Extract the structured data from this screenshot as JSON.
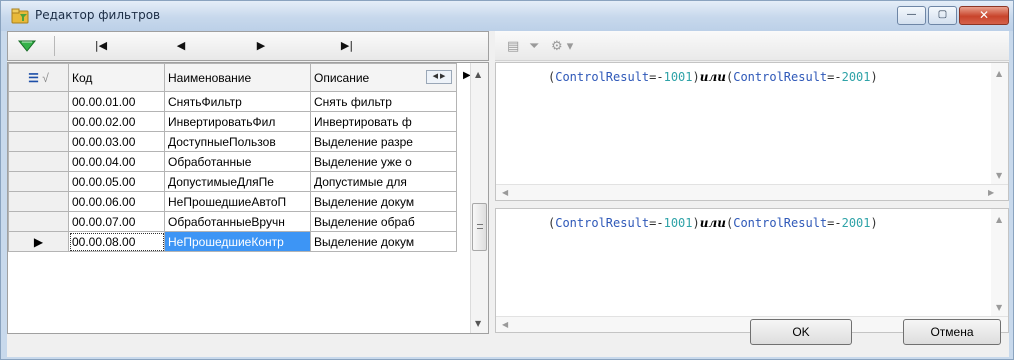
{
  "window": {
    "title": "Редактор фильтров",
    "controls": {
      "minimize": "—",
      "maximize": "▢",
      "close": "✕"
    }
  },
  "left_toolbar": {
    "filter_icon": "green-filter-icon",
    "nav": {
      "first": "|◀",
      "prev": "◀",
      "next": "▶",
      "last": "▶|"
    }
  },
  "grid": {
    "columns": [
      "Код",
      "Наименование",
      "Описание"
    ],
    "rows": [
      {
        "code": "00.00.01.00",
        "name": "СнятьФильтр",
        "desc": "Снять фильтр"
      },
      {
        "code": "00.00.02.00",
        "name": "ИнвертироватьФил",
        "desc": "Инвертировать ф"
      },
      {
        "code": "00.00.03.00",
        "name": "ДоступныеПользов",
        "desc": "Выделение разре"
      },
      {
        "code": "00.00.04.00",
        "name": "Обработанные",
        "desc": "Выделение уже о"
      },
      {
        "code": "00.00.05.00",
        "name": "ДопустимыеДляПе",
        "desc": "Допустимые для"
      },
      {
        "code": "00.00.06.00",
        "name": "НеПрошедшиеАвтоП",
        "desc": "Выделение докум"
      },
      {
        "code": "00.00.07.00",
        "name": "ОбработанныеВручн",
        "desc": "Выделение обраб"
      },
      {
        "code": "00.00.08.00",
        "name": "НеПрошедшиеКонтр",
        "desc": "Выделение докум"
      }
    ],
    "selected_index": 7,
    "row_indicator": "▶",
    "header_check": "√"
  },
  "right_toolbar": {
    "icons": [
      "grid-icon",
      "funnel-icon",
      "settings-gear-icon"
    ]
  },
  "editors": [
    {
      "tokens": [
        "(",
        "ControlResult",
        "=-",
        "1001",
        ")",
        "или",
        "(",
        "ControlResult",
        "=-",
        "2001",
        ")"
      ]
    },
    {
      "tokens": [
        "(",
        "ControlResult",
        "=-",
        "1001",
        ")",
        "или",
        "(",
        "ControlResult",
        "=-",
        "2001",
        ")"
      ]
    }
  ],
  "buttons": {
    "ok": "OK",
    "cancel": "Отмена"
  },
  "colors": {
    "selection": "#3d95f5",
    "title_gradient": "#c7d8ec",
    "code_identifier": "#2e58b8",
    "code_number": "#2fa3a8"
  }
}
